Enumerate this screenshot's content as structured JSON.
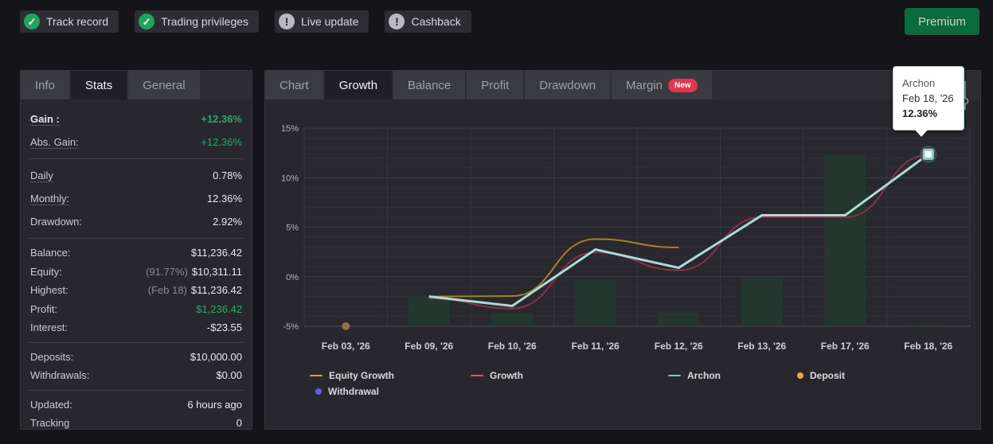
{
  "topbar": {
    "badges": [
      {
        "label": "Track record",
        "status": "ok"
      },
      {
        "label": "Trading privileges",
        "status": "ok"
      },
      {
        "label": "Live update",
        "status": "warn"
      },
      {
        "label": "Cashback",
        "status": "warn"
      }
    ],
    "premium_label": "Premium"
  },
  "stats_panel": {
    "tabs": [
      {
        "label": "Info",
        "active": false
      },
      {
        "label": "Stats",
        "active": true
      },
      {
        "label": "General",
        "active": false
      }
    ],
    "sections": [
      {
        "compact": false,
        "rows": [
          {
            "label": "Gain :",
            "labelBold": true,
            "dotted": true,
            "value": "+12.36%",
            "green": true,
            "bold": true
          },
          {
            "label": "Abs. Gain:",
            "dotted": true,
            "value": "+12.36%",
            "green": true
          }
        ]
      },
      {
        "compact": false,
        "rows": [
          {
            "label": "Daily",
            "dotted": true,
            "value": "0.78%"
          },
          {
            "label": "Monthly:",
            "dotted": true,
            "value": "12.36%"
          },
          {
            "label": "Drawdown:",
            "value": "2.92%"
          }
        ]
      },
      {
        "compact": true,
        "rows": [
          {
            "label": "Balance:",
            "value": "$11,236.42"
          },
          {
            "label": "Equity:",
            "muted": "(91.77%)",
            "value": "$10,311.11"
          },
          {
            "label": "Highest:",
            "muted": "(Feb 18)",
            "value": "$11,236.42"
          },
          {
            "label": "Profit:",
            "value": "$1,236.42",
            "green": true
          },
          {
            "label": "Interest:",
            "value": "-$23.55"
          }
        ]
      },
      {
        "compact": true,
        "rows": [
          {
            "label": "Deposits:",
            "value": "$10,000.00"
          },
          {
            "label": "Withdrawals:",
            "value": "$0.00"
          }
        ]
      },
      {
        "compact": true,
        "rows": [
          {
            "label": "Updated:",
            "value": "6 hours ago"
          },
          {
            "label": "Tracking",
            "value": "0"
          }
        ]
      }
    ]
  },
  "chart_panel": {
    "tabs": [
      {
        "label": "Chart",
        "active": false
      },
      {
        "label": "Growth",
        "active": true
      },
      {
        "label": "Balance",
        "active": false
      },
      {
        "label": "Profit",
        "active": false
      },
      {
        "label": "Drawdown",
        "active": false
      },
      {
        "label": "Margin",
        "active": false,
        "badge": "New"
      }
    ],
    "tooltip": {
      "title": "Archon",
      "date": "Feb 18, '26",
      "value": "12.36%"
    }
  },
  "chart_data": {
    "type": "line",
    "title": "",
    "xlabel": "",
    "ylabel": "",
    "categories": [
      "Feb 03, '26",
      "Feb 09, '26",
      "Feb 10, '26",
      "Feb 11, '26",
      "Feb 12, '26",
      "Feb 13, '26",
      "Feb 17, '26",
      "Feb 18, '26"
    ],
    "ylim": [
      -5,
      15
    ],
    "y_ticks": [
      15,
      10,
      5,
      0,
      -5
    ],
    "y_tick_suffix": "%",
    "grid": true,
    "legend_position": "bottom",
    "series": [
      {
        "name": "Equity Growth",
        "type": "line",
        "smooth": true,
        "color": "#a4802a",
        "legend_color": "#d2a42c",
        "width": 2,
        "points": [
          [
            1,
            -2.0
          ],
          [
            2,
            -1.95
          ],
          [
            3,
            3.8
          ],
          [
            4,
            2.95
          ]
        ]
      },
      {
        "name": "Growth",
        "type": "line",
        "smooth": true,
        "color": "#8a3040",
        "legend_color": "#e25663",
        "width": 2,
        "points": [
          [
            1,
            -2.2
          ],
          [
            2,
            -3.2
          ],
          [
            3,
            2.45
          ],
          [
            4,
            0.65
          ],
          [
            5,
            6.0
          ],
          [
            6,
            6.0
          ],
          [
            7,
            12.3
          ]
        ]
      },
      {
        "name": "Archon",
        "type": "line",
        "smooth": false,
        "color": "#aadbd6",
        "legend_color": "#8fc3bf",
        "width": 3,
        "points": [
          [
            1,
            -2.0
          ],
          [
            2,
            -2.95
          ],
          [
            3,
            2.75
          ],
          [
            4,
            0.9
          ],
          [
            5,
            6.2
          ],
          [
            6,
            6.2
          ],
          [
            7,
            12.36
          ]
        ]
      },
      {
        "name": "Deposit",
        "type": "scatter",
        "color": "#8f7347",
        "legend_color": "#efa63b",
        "points": [
          [
            0,
            -5.0
          ]
        ]
      },
      {
        "name": "Withdrawal",
        "type": "scatter",
        "color": "#5f5fe8",
        "legend_color": "#5f5fe8",
        "points": []
      }
    ],
    "bars": {
      "color": "#22382f",
      "baseline": -5,
      "points": [
        [
          1,
          -1.9
        ],
        [
          2,
          -3.7
        ],
        [
          3,
          -0.25
        ],
        [
          4,
          -3.6
        ],
        [
          5,
          -0.1
        ],
        [
          6,
          12.3
        ],
        [
          7,
          -4.85
        ]
      ]
    },
    "highlight": {
      "series": "Archon",
      "x": 7,
      "value": 12.36
    }
  }
}
